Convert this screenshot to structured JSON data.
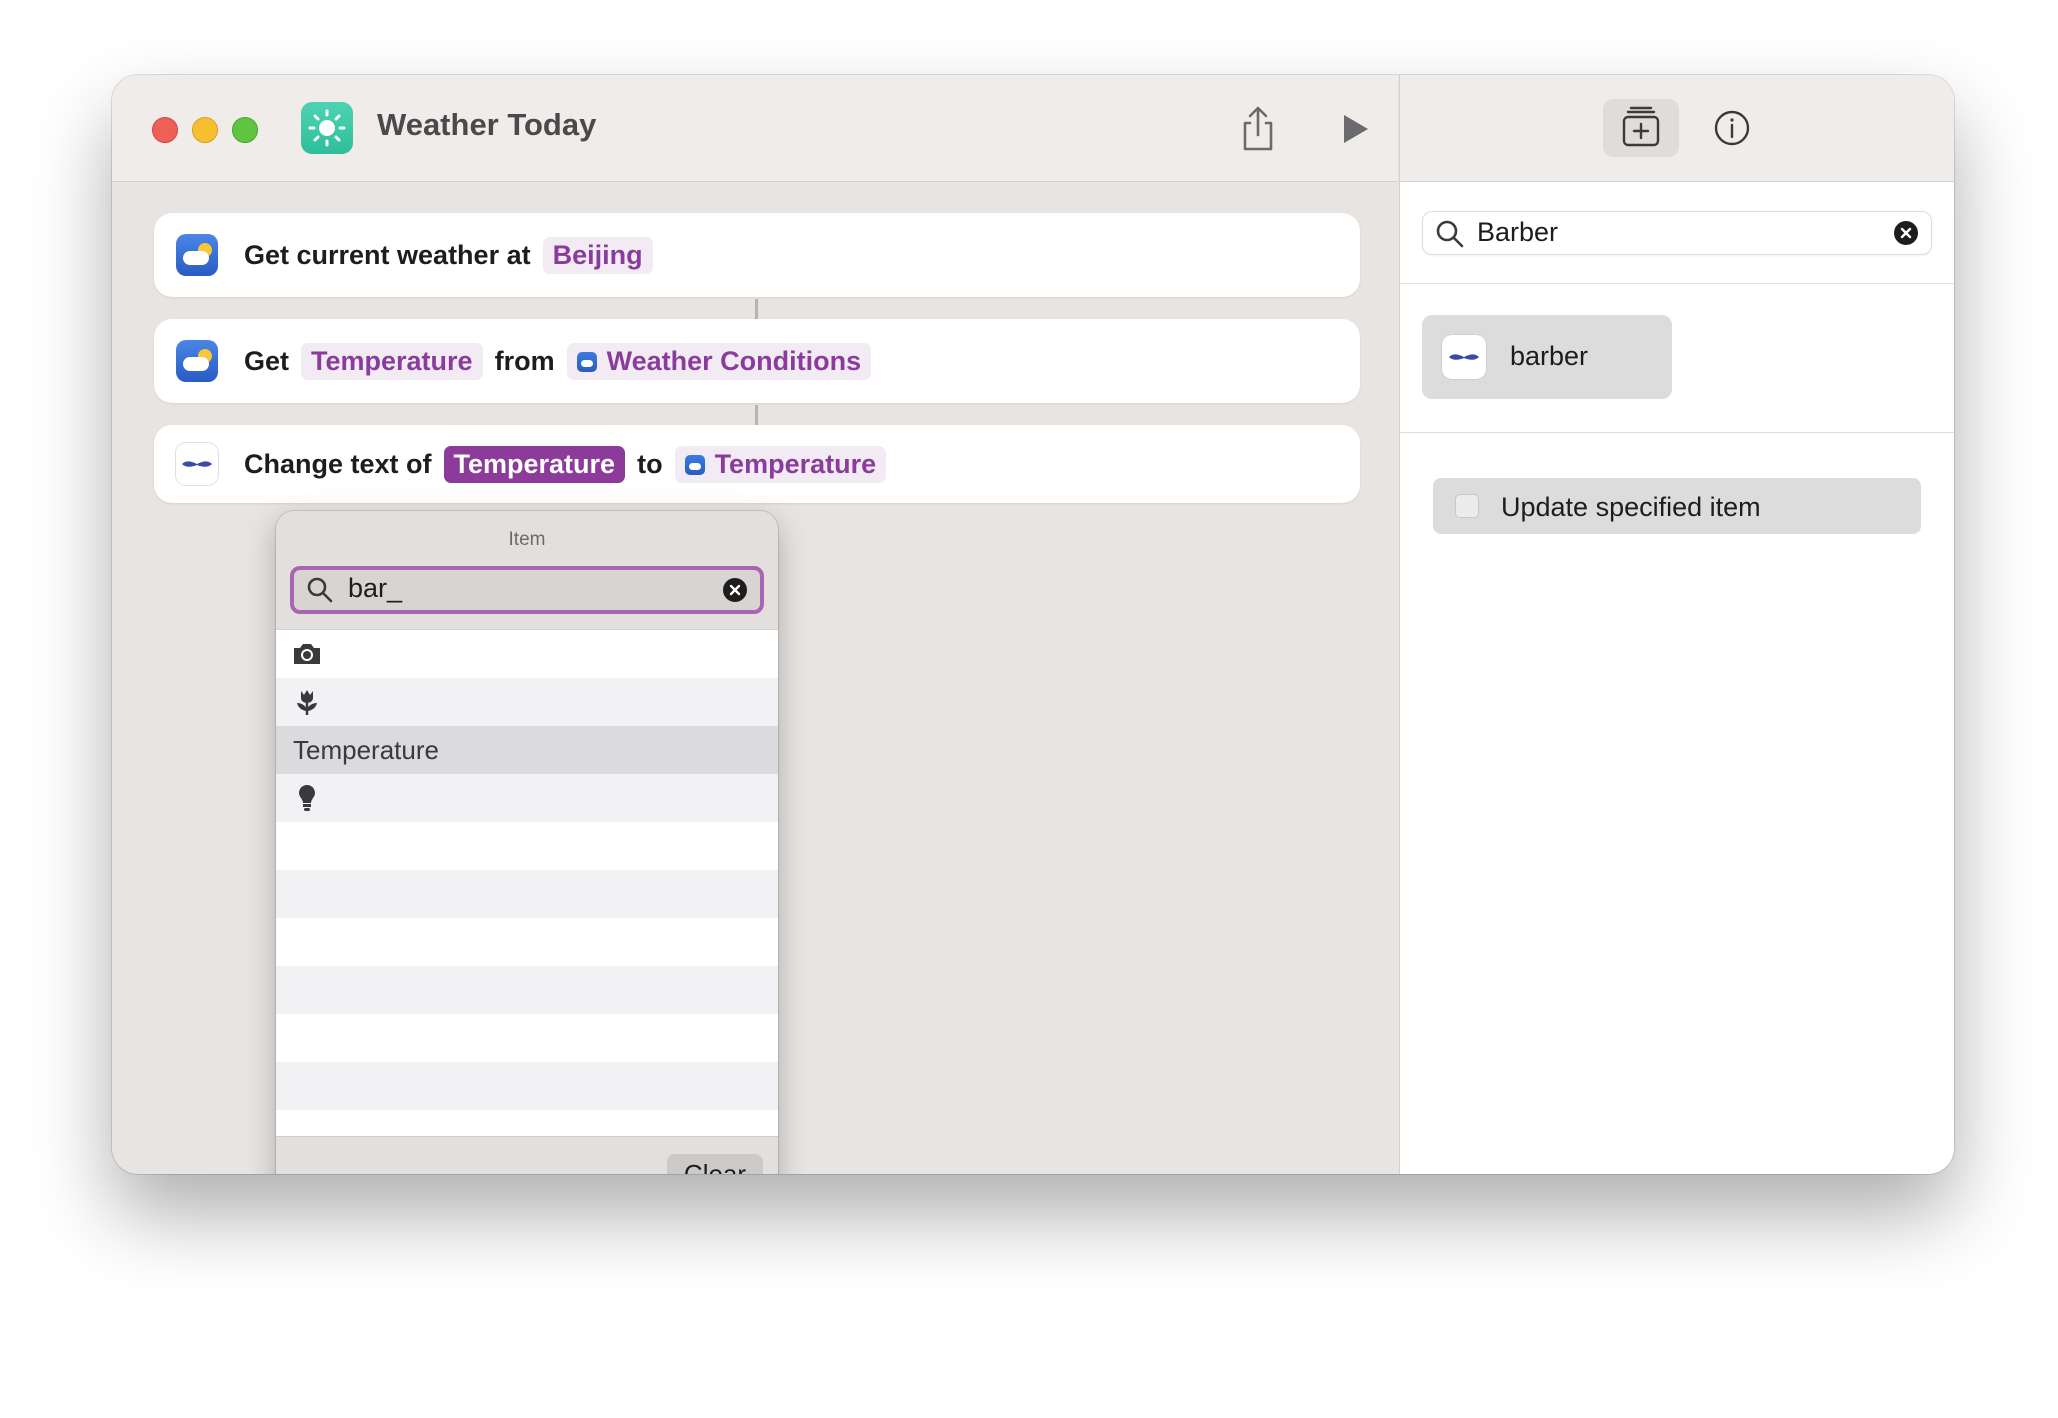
{
  "window": {
    "title": "Weather Today",
    "app_icon": "sun-icon"
  },
  "toolbar": {
    "share_icon": "share-icon",
    "run_icon": "play-icon"
  },
  "actions": [
    {
      "icon": "weather-icon",
      "text": "Get current weather at",
      "location": "Beijing"
    },
    {
      "icon": "weather-icon",
      "prefix": "Get",
      "property": "Temperature",
      "middle": "from",
      "source": "Weather Conditions"
    },
    {
      "icon": "mustache-icon",
      "prefix": "Change text of",
      "target": "Temperature",
      "middle": "to",
      "value": "Temperature"
    }
  ],
  "popover": {
    "title": "Item",
    "search_value": "bar_",
    "rows": [
      {
        "type": "icon",
        "icon": "camera-icon"
      },
      {
        "type": "icon",
        "icon": "tulip-icon"
      },
      {
        "type": "text",
        "text": "Temperature",
        "selected": true
      },
      {
        "type": "icon",
        "icon": "lightbulb-icon"
      }
    ],
    "clear_label": "Clear"
  },
  "sidebar": {
    "search_value": "Barber",
    "app_result": {
      "label": "barber",
      "icon": "mustache-icon"
    },
    "action_result": {
      "label": "Update specified item"
    }
  },
  "colors": {
    "token_text": "#8a3c9c",
    "token_selected_bg": "#8c3b9a",
    "search_focus_ring": "#a964b4"
  }
}
